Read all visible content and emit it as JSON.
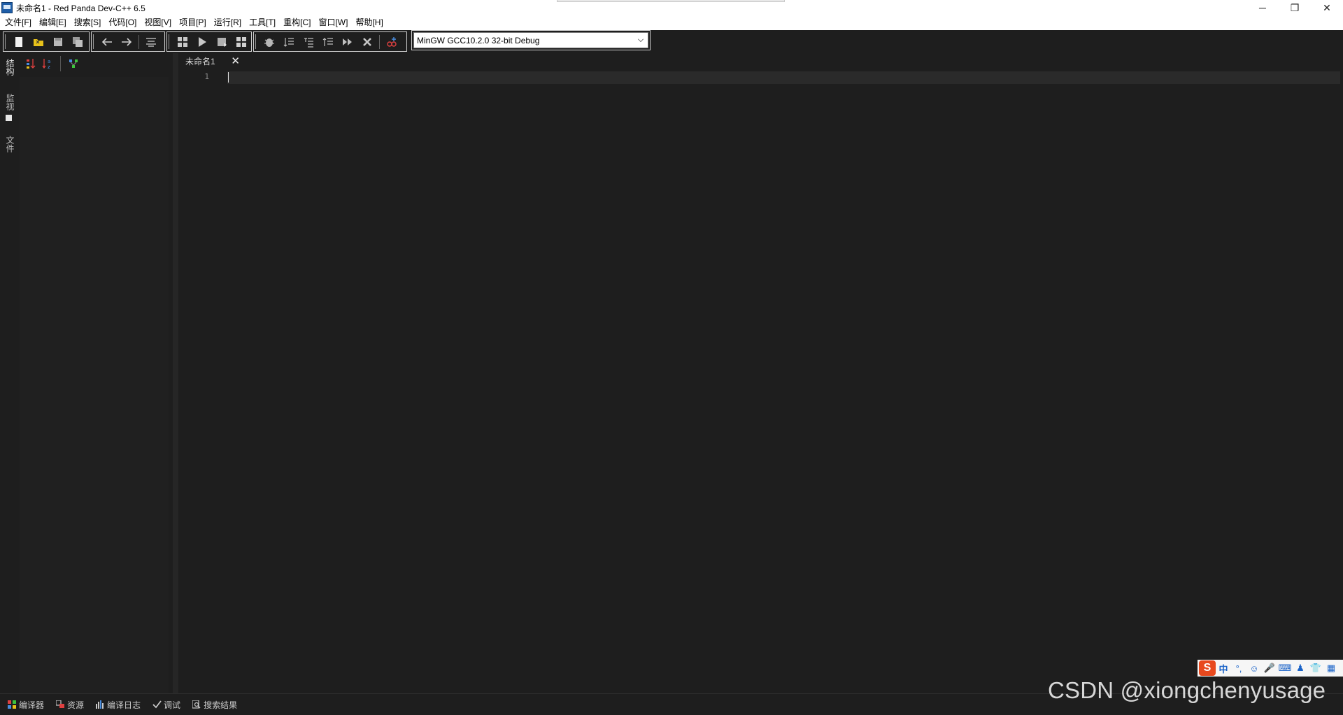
{
  "window": {
    "title": "未命名1 - Red Panda Dev-C++ 6.5",
    "controls": {
      "minimize": "─",
      "restore": "❐",
      "close": "✕"
    }
  },
  "menu": {
    "items": [
      "文件[F]",
      "编辑[E]",
      "搜索[S]",
      "代码[O]",
      "视图[V]",
      "项目[P]",
      "运行[R]",
      "工具[T]",
      "重构[C]",
      "窗口[W]",
      "帮助[H]"
    ]
  },
  "toolbar": {
    "compiler_value": "MinGW GCC10.2.0 32-bit Debug"
  },
  "left_tabs": [
    "结构",
    "监视",
    "文件"
  ],
  "editor": {
    "tab_label": "未命名1",
    "tab_close": "✕",
    "line_numbers": [
      "1"
    ]
  },
  "bottom_tabs": [
    "编译器",
    "资源",
    "编译日志",
    "调试",
    "搜索结果"
  ],
  "ime": {
    "logo": "S",
    "items": [
      "中",
      "°,",
      "☺",
      "🎤",
      "⌨",
      "♟",
      "👕",
      "▦"
    ]
  },
  "watermark": "CSDN @xiongchenyusage",
  "colors": {
    "background": "#1e1e1e",
    "chrome": "#ffffff",
    "tab_close": "#f0f0f0",
    "ime_brand": "#e8491e"
  }
}
